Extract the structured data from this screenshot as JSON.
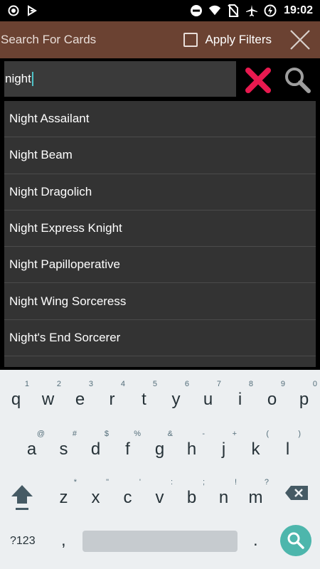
{
  "status_bar": {
    "time": "19:02",
    "icons_left": [
      "record-icon",
      "download-icon"
    ],
    "icons_right": [
      "do-not-disturb-icon",
      "wifi-icon",
      "no-sim-icon",
      "airplane-mode-icon",
      "data-saver-icon"
    ]
  },
  "toolbar": {
    "title": "Search For Cards",
    "apply_filters_label": "Apply Filters",
    "apply_filters_checked": false
  },
  "search": {
    "value": "night"
  },
  "results": [
    "Night Assailant",
    "Night Beam",
    "Night Dragolich",
    "Night Express Knight",
    "Night Papilloperative",
    "Night Wing Sorceress",
    "Night's End Sorcerer",
    ""
  ],
  "keyboard": {
    "row1": [
      {
        "k": "q",
        "h": "1"
      },
      {
        "k": "w",
        "h": "2"
      },
      {
        "k": "e",
        "h": "3"
      },
      {
        "k": "r",
        "h": "4"
      },
      {
        "k": "t",
        "h": "5"
      },
      {
        "k": "y",
        "h": "6"
      },
      {
        "k": "u",
        "h": "7"
      },
      {
        "k": "i",
        "h": "8"
      },
      {
        "k": "o",
        "h": "9"
      },
      {
        "k": "p",
        "h": "0"
      }
    ],
    "row2": [
      {
        "k": "a",
        "h": "@"
      },
      {
        "k": "s",
        "h": "#"
      },
      {
        "k": "d",
        "h": "$"
      },
      {
        "k": "f",
        "h": "%"
      },
      {
        "k": "g",
        "h": "&"
      },
      {
        "k": "h",
        "h": "-"
      },
      {
        "k": "j",
        "h": "+"
      },
      {
        "k": "k",
        "h": "("
      },
      {
        "k": "l",
        "h": ")"
      }
    ],
    "row3": [
      {
        "k": "z",
        "h": "*"
      },
      {
        "k": "x",
        "h": "\""
      },
      {
        "k": "c",
        "h": "'"
      },
      {
        "k": "v",
        "h": ":"
      },
      {
        "k": "b",
        "h": ";"
      },
      {
        "k": "n",
        "h": "!"
      },
      {
        "k": "m",
        "h": "?"
      }
    ],
    "symbols_label": "?123",
    "comma": ",",
    "period": "."
  }
}
